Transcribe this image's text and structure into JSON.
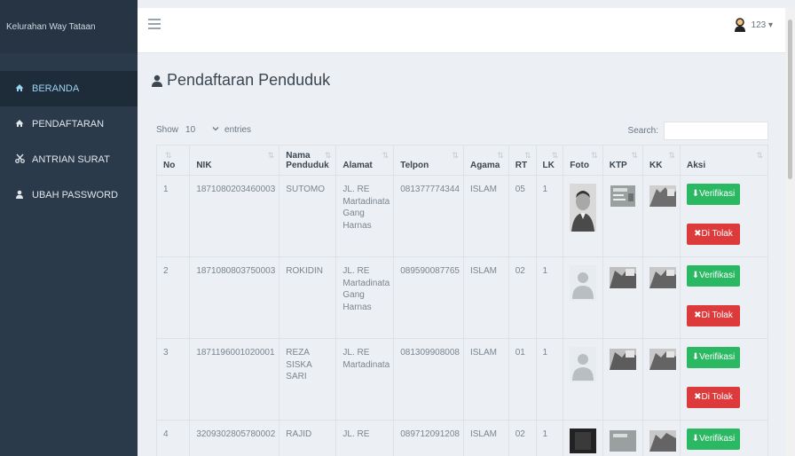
{
  "brand": "Kelurahan Way Tataan",
  "nav": [
    {
      "label": "BERANDA",
      "icon": "home-icon"
    },
    {
      "label": "PENDAFTARAN",
      "icon": "home-icon"
    },
    {
      "label": "ANTRIAN SURAT",
      "icon": "scissors-icon"
    },
    {
      "label": "UBAH PASSWORD",
      "icon": "user-icon"
    }
  ],
  "topbar": {
    "user": "123 ▾"
  },
  "page": {
    "title": "Pendaftaran Penduduk",
    "icon": "user-icon"
  },
  "table_controls": {
    "show": "Show",
    "length": "10",
    "entries": "entries",
    "search": "Search:"
  },
  "columns": [
    "No",
    "NIK",
    "Nama Penduduk",
    "Alamat",
    "Telpon",
    "Agama",
    "RT",
    "LK",
    "Foto",
    "KTP",
    "KK",
    "Aksi"
  ],
  "actions": {
    "verify": "⬇Verifikasi",
    "reject": "✖Di Tolak"
  },
  "rows": [
    {
      "no": "1",
      "nik": "1871080203460003",
      "nama": "SUTOMO",
      "alamat": "JL. RE Martadinata Gang Harnas",
      "telpon": "081377774344",
      "agama": "ISLAM",
      "rt": "05",
      "lk": "1",
      "foto": "portrait"
    },
    {
      "no": "2",
      "nik": "1871080803750003",
      "nama": "ROKIDIN",
      "alamat": "JL. RE Martadinata Gang Harnas",
      "telpon": "089590087765",
      "agama": "ISLAM",
      "rt": "02",
      "lk": "1",
      "foto": "placeholder"
    },
    {
      "no": "3",
      "nik": "1871196001020001",
      "nama": "REZA SISKA SARI",
      "alamat": "JL. RE Martadinata",
      "telpon": "081309908008",
      "agama": "ISLAM",
      "rt": "01",
      "lk": "1",
      "foto": "placeholder"
    },
    {
      "no": "4",
      "nik": "3209302805780002",
      "nama": "RAJID",
      "alamat": "JL. RE",
      "telpon": "089712091208",
      "agama": "ISLAM",
      "rt": "02",
      "lk": "1",
      "foto": "dark"
    }
  ],
  "colors": {
    "sidebar": "#2b3a4a",
    "active": "#9ad4f5",
    "verify": "#2bb863",
    "reject": "#dd3b3b"
  }
}
